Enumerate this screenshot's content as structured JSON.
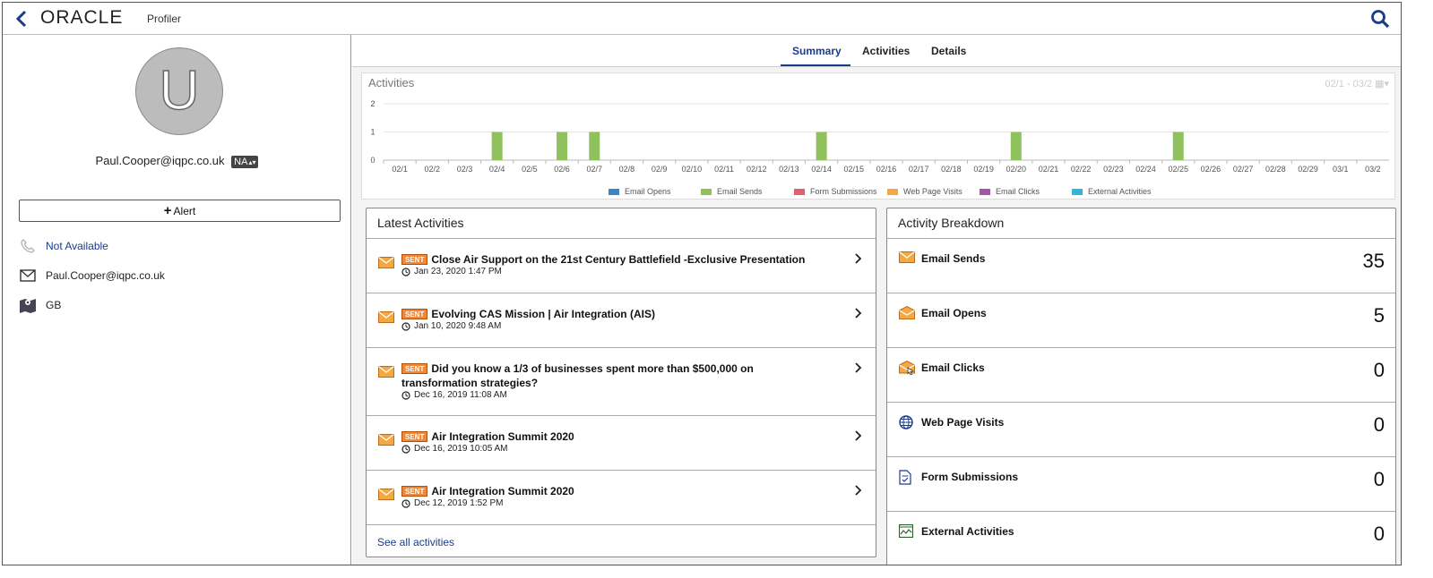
{
  "header": {
    "logo": "ORACLE",
    "app_name": "Profiler"
  },
  "profile": {
    "avatar_letter": "U",
    "email": "Paul.Cooper@iqpc.co.uk",
    "badge": "NA",
    "alert_label": "Alert",
    "phone": "Not Available",
    "email_contact": "Paul.Cooper@iqpc.co.uk",
    "country": "GB"
  },
  "tabs": [
    "Summary",
    "Activities",
    "Details"
  ],
  "activities_chart": {
    "title": "Activities",
    "range": "02/1 - 03/2"
  },
  "chart_data": {
    "type": "bar",
    "title": "Activities",
    "categories": [
      "02/1",
      "02/2",
      "02/3",
      "02/4",
      "02/5",
      "02/6",
      "02/7",
      "02/8",
      "02/9",
      "02/10",
      "02/11",
      "02/12",
      "02/13",
      "02/14",
      "02/15",
      "02/16",
      "02/17",
      "02/18",
      "02/19",
      "02/20",
      "02/21",
      "02/22",
      "02/23",
      "02/24",
      "02/25",
      "02/26",
      "02/27",
      "02/28",
      "02/29",
      "03/1",
      "03/2"
    ],
    "series": [
      {
        "name": "Email Opens",
        "color": "#3d85c6",
        "values": [
          0,
          0,
          0,
          0,
          0,
          0,
          0,
          0,
          0,
          0,
          0,
          0,
          0,
          0,
          0,
          0,
          0,
          0,
          0,
          0,
          0,
          0,
          0,
          0,
          0,
          0,
          0,
          0,
          0,
          0,
          0
        ]
      },
      {
        "name": "Email Sends",
        "color": "#8fc15c",
        "values": [
          0,
          0,
          0,
          1,
          0,
          1,
          1,
          0,
          0,
          0,
          0,
          0,
          0,
          1,
          0,
          0,
          0,
          0,
          0,
          1,
          0,
          0,
          0,
          0,
          1,
          0,
          0,
          0,
          0,
          0,
          0
        ]
      },
      {
        "name": "Form Submissions",
        "color": "#e06070",
        "values": [
          0,
          0,
          0,
          0,
          0,
          0,
          0,
          0,
          0,
          0,
          0,
          0,
          0,
          0,
          0,
          0,
          0,
          0,
          0,
          0,
          0,
          0,
          0,
          0,
          0,
          0,
          0,
          0,
          0,
          0,
          0
        ]
      },
      {
        "name": "Web Page Visits",
        "color": "#f5a742",
        "values": [
          0,
          0,
          0,
          0,
          0,
          0,
          0,
          0,
          0,
          0,
          0,
          0,
          0,
          0,
          0,
          0,
          0,
          0,
          0,
          0,
          0,
          0,
          0,
          0,
          0,
          0,
          0,
          0,
          0,
          0,
          0
        ]
      },
      {
        "name": "Email Clicks",
        "color": "#a855a8",
        "values": [
          0,
          0,
          0,
          0,
          0,
          0,
          0,
          0,
          0,
          0,
          0,
          0,
          0,
          0,
          0,
          0,
          0,
          0,
          0,
          0,
          0,
          0,
          0,
          0,
          0,
          0,
          0,
          0,
          0,
          0,
          0
        ]
      },
      {
        "name": "External Activities",
        "color": "#2db8d8",
        "values": [
          0,
          0,
          0,
          0,
          0,
          0,
          0,
          0,
          0,
          0,
          0,
          0,
          0,
          0,
          0,
          0,
          0,
          0,
          0,
          0,
          0,
          0,
          0,
          0,
          0,
          0,
          0,
          0,
          0,
          0,
          0
        ]
      }
    ],
    "yticks": [
      0,
      1,
      2
    ],
    "ylim": [
      0,
      2
    ],
    "grid": true,
    "legend": "bottom"
  },
  "latest_activities": {
    "title": "Latest Activities",
    "badge": "SENT",
    "items": [
      {
        "title": "Close Air Support on the 21st Century Battlefield -Exclusive Presentation",
        "date": "Jan 23, 2020 1:47 PM"
      },
      {
        "title": "Evolving CAS Mission | Air Integration (AIS)",
        "date": "Jan 10, 2020 9:48 AM"
      },
      {
        "title": "Did you know a 1/3 of businesses spent more than $500,000 on transformation strategies?",
        "date": "Dec 16, 2019 11:08 AM"
      },
      {
        "title": "Air Integration Summit 2020",
        "date": "Dec 16, 2019 10:05 AM"
      },
      {
        "title": "Air Integration Summit 2020",
        "date": "Dec 12, 2019 1:52 PM"
      }
    ],
    "see_all": "See all activities"
  },
  "breakdown": {
    "title": "Activity Breakdown",
    "items": [
      {
        "label": "Email Sends",
        "value": "35",
        "icon": "envelope-icon"
      },
      {
        "label": "Email Opens",
        "value": "5",
        "icon": "open-envelope-icon"
      },
      {
        "label": "Email Clicks",
        "value": "0",
        "icon": "envelope-click-icon"
      },
      {
        "label": "Web Page Visits",
        "value": "0",
        "icon": "globe-icon"
      },
      {
        "label": "Form Submissions",
        "value": "0",
        "icon": "form-icon"
      },
      {
        "label": "External Activities",
        "value": "0",
        "icon": "chart-box-icon"
      }
    ]
  }
}
